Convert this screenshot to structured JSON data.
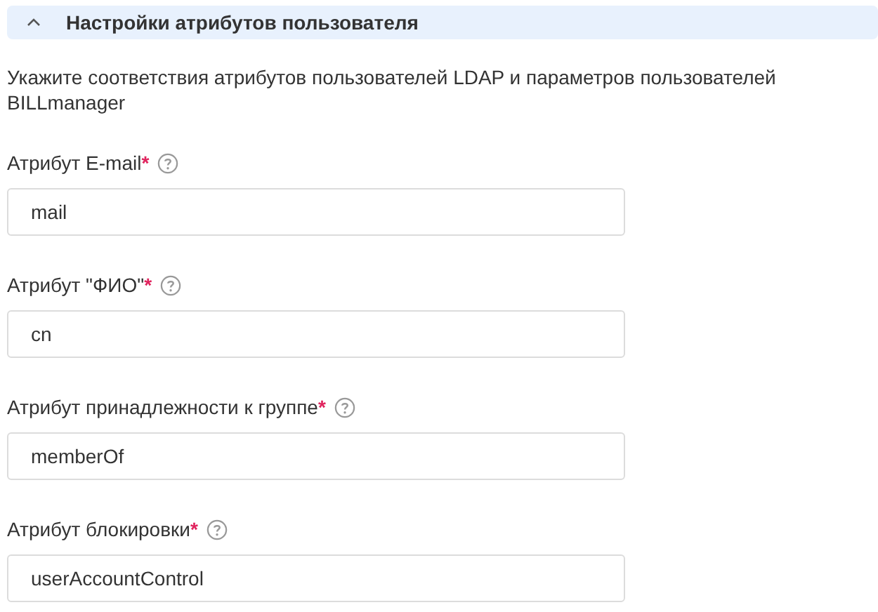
{
  "section": {
    "title": "Настройки атрибутов пользователя",
    "expanded": true
  },
  "description": "Укажите соответствия атрибутов пользователей LDAP и параметров пользователей BILLmanager",
  "fields": [
    {
      "label": "Атрибут E-mail",
      "required_mark": "*",
      "value": "mail"
    },
    {
      "label": "Атрибут \"ФИО\"",
      "required_mark": "*",
      "value": "cn"
    },
    {
      "label": "Атрибут принадлежности к группе",
      "required_mark": "*",
      "value": "memberOf"
    },
    {
      "label": "Атрибут блокировки",
      "required_mark": "*",
      "value": "userAccountControl"
    }
  ]
}
